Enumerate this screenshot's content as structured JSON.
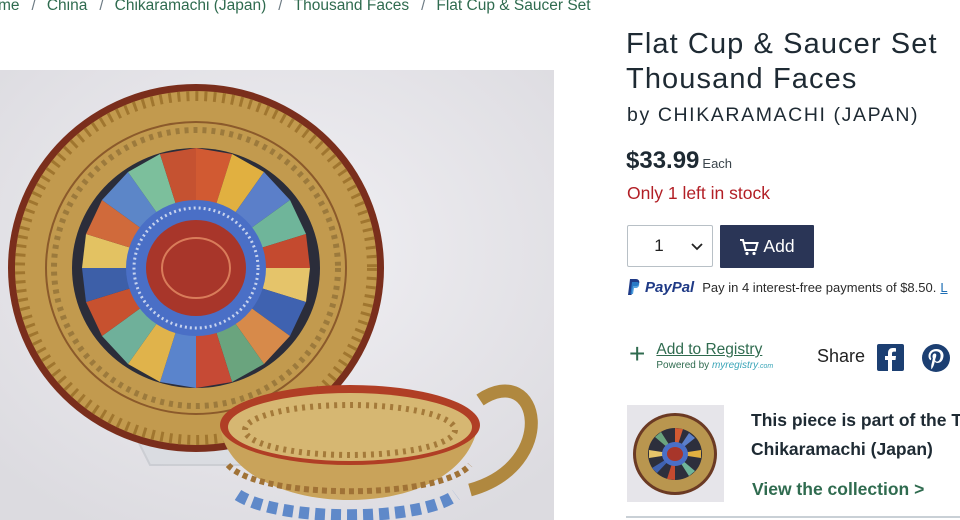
{
  "breadcrumb": {
    "items": [
      "me",
      "China",
      "Chikaramachi (Japan)",
      "Thousand Faces",
      "Flat Cup & Saucer Set"
    ],
    "separator": "/"
  },
  "product": {
    "title_line1": "Flat Cup & Saucer Set",
    "title_line2": "Thousand Faces",
    "byline": "by CHIKARAMACHI (JAPAN)",
    "price": "$33.99",
    "price_unit": "Each",
    "stock": "Only 1 left in stock"
  },
  "cart": {
    "quantity": "1",
    "add_label": "Add"
  },
  "paypal": {
    "brand": "PayPal",
    "text": "Pay in 4 interest-free payments of $8.50.",
    "link": "L"
  },
  "registry": {
    "plus": "+",
    "link": "Add to Registry",
    "powered_prefix": "Powered by",
    "powered_brand": "myregistry",
    "powered_suffix": ".com"
  },
  "share": {
    "label": "Share"
  },
  "collection": {
    "text_line1": "This piece is part of the Tho",
    "text_line2": "Chikaramachi (Japan)",
    "link": "View the collection >"
  },
  "colors": {
    "accent_green": "#2f6b4f",
    "stock_red": "#b21e25",
    "button_navy": "#2a3556",
    "social_blue": "#1c3f72"
  },
  "icons": [
    "chevron-down-icon",
    "cart-icon",
    "paypal-icon",
    "plus-icon",
    "facebook-icon",
    "pinterest-icon"
  ]
}
